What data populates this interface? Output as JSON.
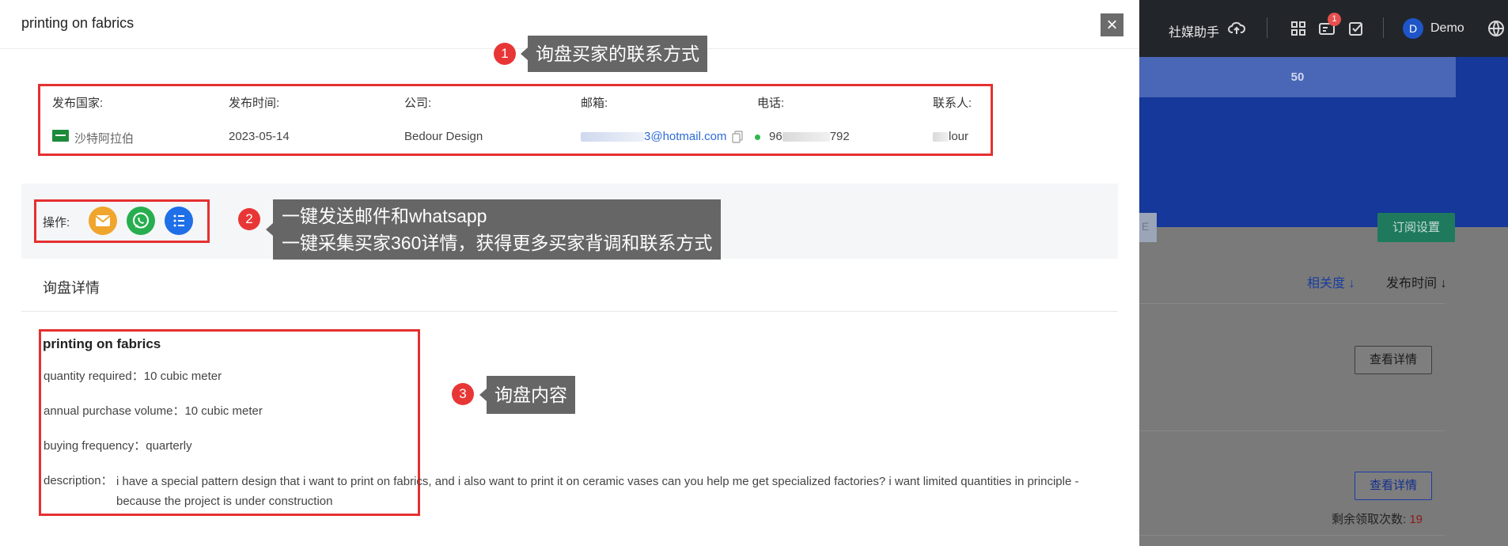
{
  "modal": {
    "title": "printing on fabrics",
    "close_glyph": "×",
    "info": {
      "labels": {
        "country": "发布国家:",
        "date": "发布时间:",
        "company": "公司:",
        "email": "邮箱:",
        "phone": "电话:",
        "contact": "联系人:"
      },
      "country": "沙特阿拉伯",
      "country_flag_icon": "saudi-arabia-flag",
      "date": "2023-05-14",
      "company": "Bedour Design",
      "email_suffix": "3@hotmail.com",
      "phone_prefix": "96",
      "phone_suffix": "792",
      "contact_suffix": "lour"
    },
    "operations": {
      "label": "操作:",
      "buttons": [
        {
          "name": "email",
          "icon": "mail-icon",
          "color": "#f0a52c"
        },
        {
          "name": "whatsapp",
          "icon": "whatsapp-icon",
          "color": "#27ae4f"
        },
        {
          "name": "buyer-360",
          "icon": "list-icon",
          "color": "#1e6fe8"
        }
      ]
    },
    "details": {
      "section_title": "询盘详情",
      "title": "printing on fabrics",
      "quantity": "quantity required：10 cubic meter",
      "annual_volume": "annual purchase volume：10 cubic meter",
      "frequency": "buying frequency：quarterly",
      "description_label": "description：",
      "description": "i have a special pattern design that i want to print on fabrics, and i also want to print it on ceramic vases can you help me get specialized factories? i want limited quantities in principle - because the project is under construction"
    }
  },
  "callouts": [
    {
      "number": "1",
      "text": "询盘买家的联系方式"
    },
    {
      "number": "2",
      "line1": "一键发送邮件和whatsapp",
      "line2": "一键采集买家360详情，获得更多买家背调和联系方式"
    },
    {
      "number": "3",
      "text": "询盘内容"
    }
  ],
  "background_app": {
    "topbar": {
      "social_assistant": "社媒助手",
      "notification_count": "1",
      "avatar_initial": "D",
      "user_name": "Demo"
    },
    "hero_value": "50",
    "subscribe_button": "订阅设置",
    "left_chip_text": "E",
    "sort_relevance": "相关度",
    "sort_date": "发布时间",
    "view_details": "查看详情",
    "remaining_label": "剩余领取次数:",
    "remaining_count": "19",
    "colors": {
      "topbar": "#22262b",
      "hero": "#15389a",
      "accent_red": "#e53030"
    }
  }
}
